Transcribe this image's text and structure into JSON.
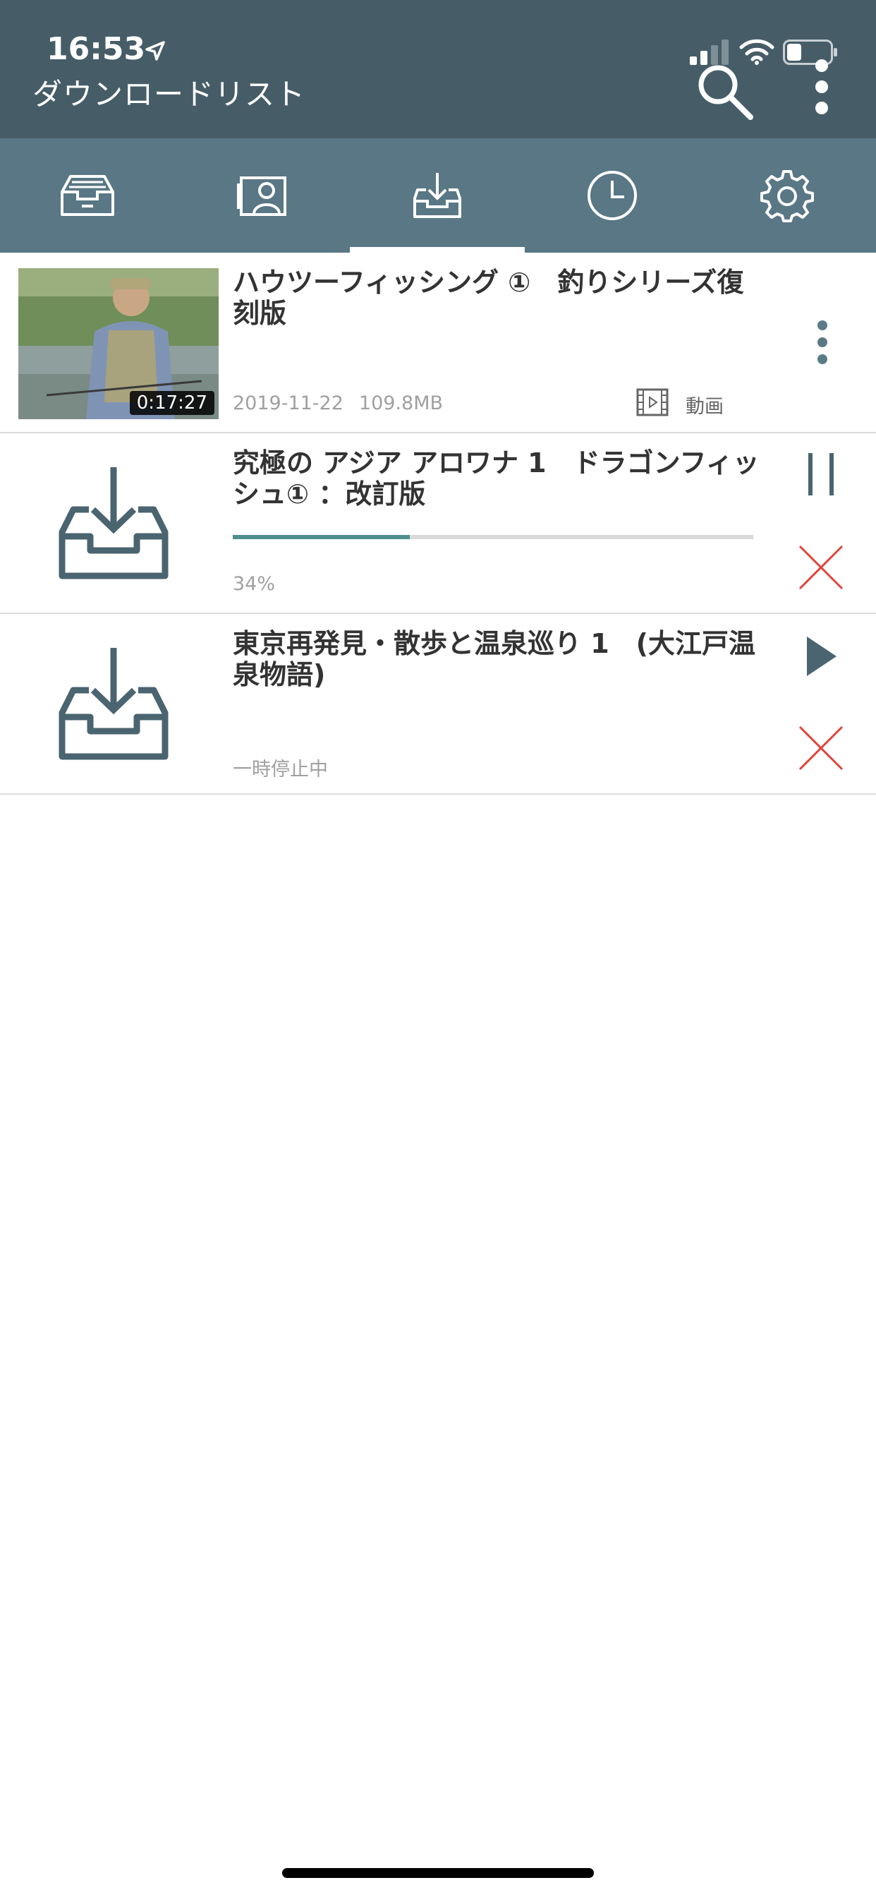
{
  "status_bar": {
    "time": "16:53"
  },
  "header": {
    "title": "ダウンロードリスト",
    "search_icon": "search-icon",
    "more_icon": "more-vertical-icon"
  },
  "tabs": [
    {
      "icon": "inbox-tray-icon"
    },
    {
      "icon": "contact-card-icon"
    },
    {
      "icon": "download-tray-icon",
      "selected": true
    },
    {
      "icon": "clock-icon"
    },
    {
      "icon": "gear-icon"
    }
  ],
  "downloads": [
    {
      "title": "ハウツーフィッシング ①　釣りシリーズ復刻版",
      "duration": "0:17:27",
      "date": "2019-11-22",
      "size": "109.8MB",
      "type_label": "動画"
    },
    {
      "title": "究極の アジア アロワナ 1　ドラゴンフィッシュ① ：改訂版",
      "progress_label": "34%",
      "progress": 0.34
    },
    {
      "title": "東京再発見・散歩と温泉巡り 1　(大江戸温泉物語)",
      "status": "一時停止中"
    }
  ],
  "colors": {
    "header": "#465d68",
    "tabbar": "#597784",
    "progress": "#4f8f8f",
    "cancel": "#e0443a",
    "icon": "#4a6470"
  }
}
